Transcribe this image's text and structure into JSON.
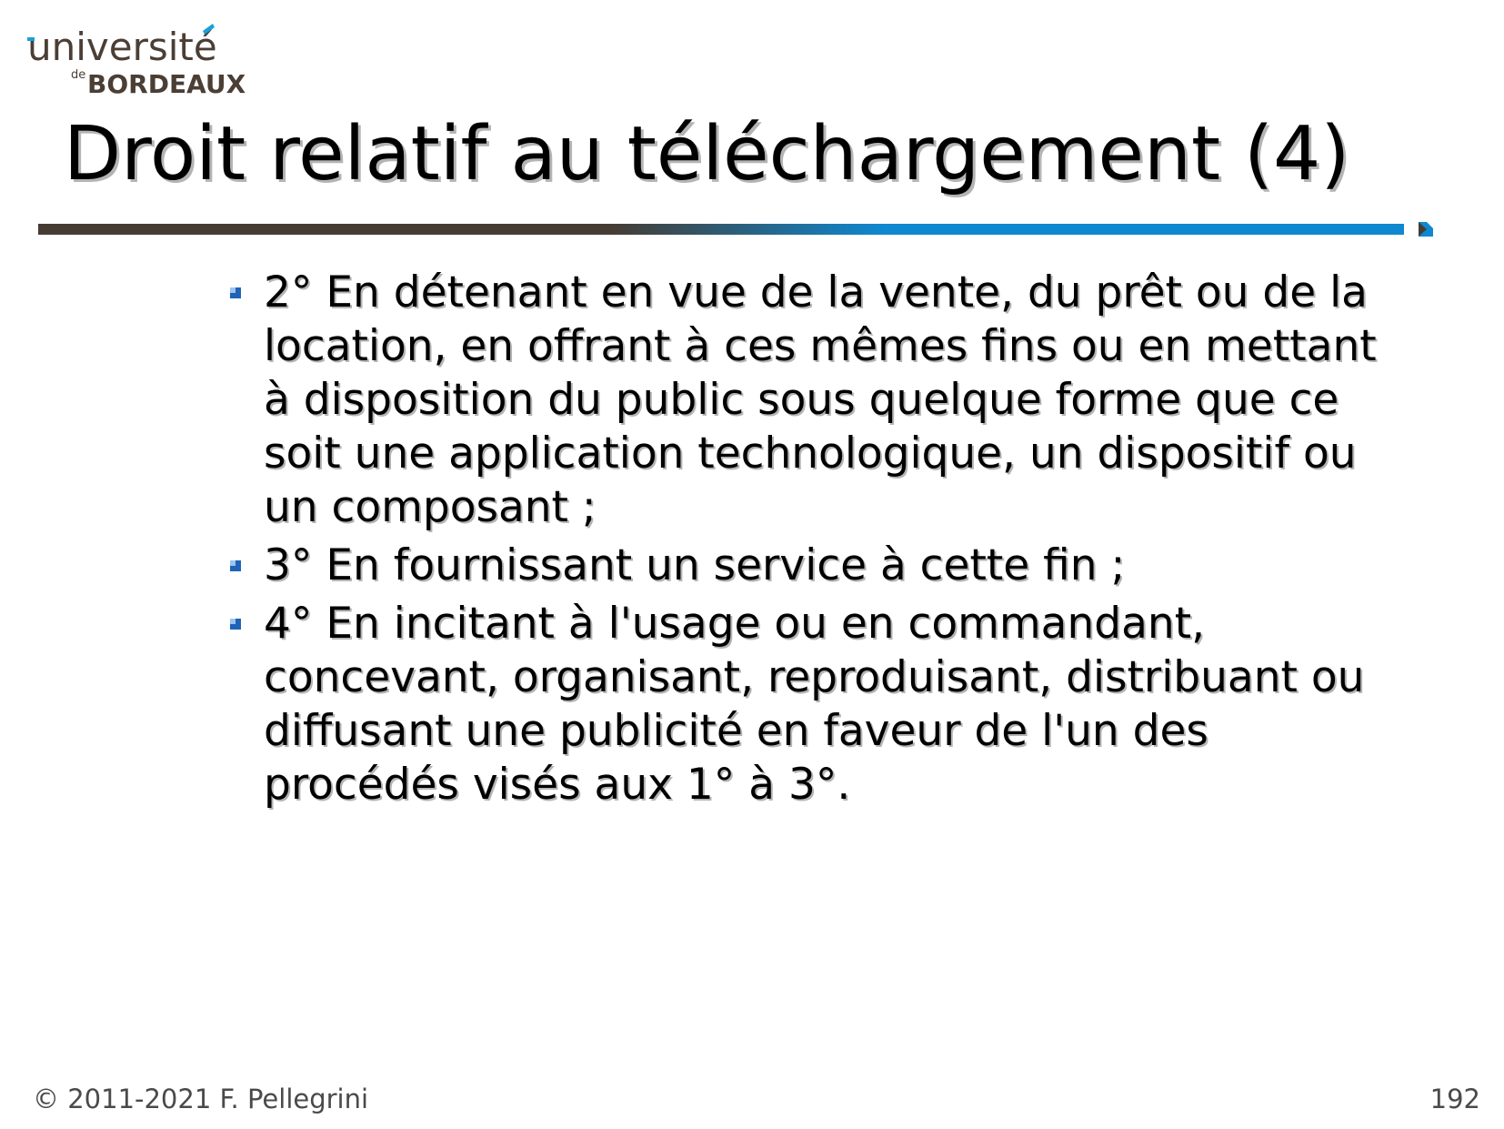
{
  "logo": {
    "university": "université",
    "prefix": "de",
    "city": "BORDEAUX"
  },
  "slide": {
    "title": "Droit relatif au téléchargement (4)",
    "bullets": [
      "2° En détenant en vue de la vente, du prêt ou de la location, en offrant à ces mêmes fins ou en mettant à disposition du public sous quelque forme que ce soit une application technologique, un dispositif ou un composant ;",
      "3° En fournissant un service à cette fin ;",
      "4° En incitant à l'usage ou en commandant, concevant, organisant, reproduisant, distribuant ou diffusant une publicité en faveur de l'un des procédés visés aux 1° à 3°."
    ]
  },
  "footer": {
    "copyright": "© 2011-2021 F. Pellegrini",
    "page_number": "192"
  },
  "colors": {
    "logo_text": "#4a3e35",
    "logo_accent": "#1aa0d8",
    "rule_dark": "#463c34",
    "rule_blue": "#0e88d0",
    "bullet_blue": "#1f63b8",
    "text": "#000000",
    "text_shadow": "#b4b4b4",
    "footer_text": "#4a4a4a"
  },
  "icons": {
    "logo": "universite-de-bordeaux-logo",
    "bullet": "blue-square-bullet-icon",
    "corner": "slide-corner-mark-icon"
  }
}
